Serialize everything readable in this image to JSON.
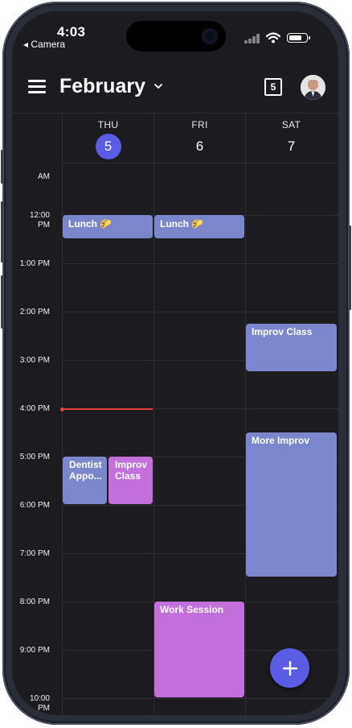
{
  "status_bar": {
    "time": "4:03",
    "back_label": "◂ Camera"
  },
  "header": {
    "month": "February",
    "today_day": "5"
  },
  "days": [
    {
      "name": "THU",
      "number": "5",
      "is_today": true
    },
    {
      "name": "FRI",
      "number": "6",
      "is_today": false
    },
    {
      "name": "SAT",
      "number": "7",
      "is_today": false
    }
  ],
  "hour_labels": {
    "am": "AM",
    "h12": "12:00\nPM",
    "h13": "1:00 PM",
    "h14": "2:00 PM",
    "h15": "3:00 PM",
    "h16": "4:00 PM",
    "h17": "5:00 PM",
    "h18": "6:00 PM",
    "h19": "7:00 PM",
    "h20": "8:00 PM",
    "h21": "9:00 PM",
    "h22": "10:00\nPM"
  },
  "events": {
    "thu_lunch": "Lunch 🌮",
    "fri_lunch": "Lunch 🌮",
    "sat_improv": "Improv Class",
    "sat_more_improv": "More Improv",
    "thu_dentist": "Dentist Appo...",
    "thu_improv": "Improv Class",
    "fri_work": "Work Session"
  },
  "colors": {
    "accent": "#5b5ce6",
    "event_blue": "#7b86cc",
    "event_pink": "#c36fdc",
    "now_line": "#e0443e",
    "background": "#1c1b1f"
  },
  "icons": {
    "menu": "hamburger-icon",
    "month_dropdown": "chevron-down-icon",
    "today": "calendar-today-icon",
    "add": "plus-icon"
  }
}
